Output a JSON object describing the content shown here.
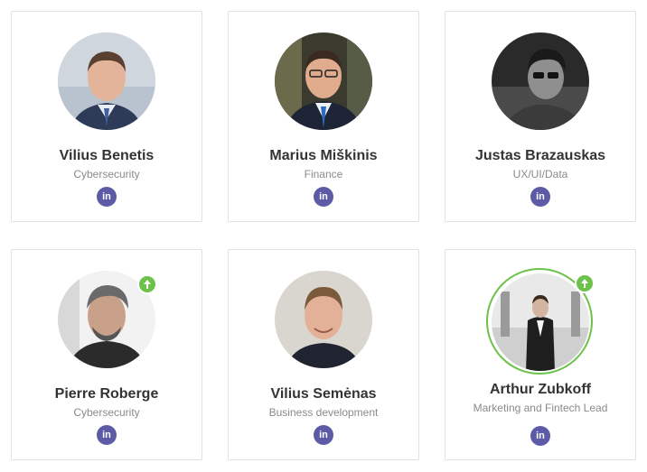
{
  "team": [
    {
      "name": "Vilius Benetis",
      "role": "Cybersecurity",
      "linkedin_label": "in",
      "badge": false
    },
    {
      "name": "Marius Miškinis",
      "role": "Finance",
      "linkedin_label": "in",
      "badge": false
    },
    {
      "name": "Justas Brazauskas",
      "role": "UX/UI/Data",
      "linkedin_label": "in",
      "badge": false
    },
    {
      "name": "Pierre Roberge",
      "role": "Cybersecurity",
      "linkedin_label": "in",
      "badge": true
    },
    {
      "name": "Vilius Semėnas",
      "role": "Business development",
      "linkedin_label": "in",
      "badge": false
    },
    {
      "name": "Arthur Zubkoff",
      "role": "Marketing and Fintech Lead",
      "linkedin_label": "in",
      "badge": true
    }
  ],
  "colors": {
    "linkedin": "#5b5ba8",
    "badge": "#6cc24a",
    "name_text": "#333333",
    "role_text": "#8a8a8a",
    "card_border": "#e2e2e2"
  }
}
